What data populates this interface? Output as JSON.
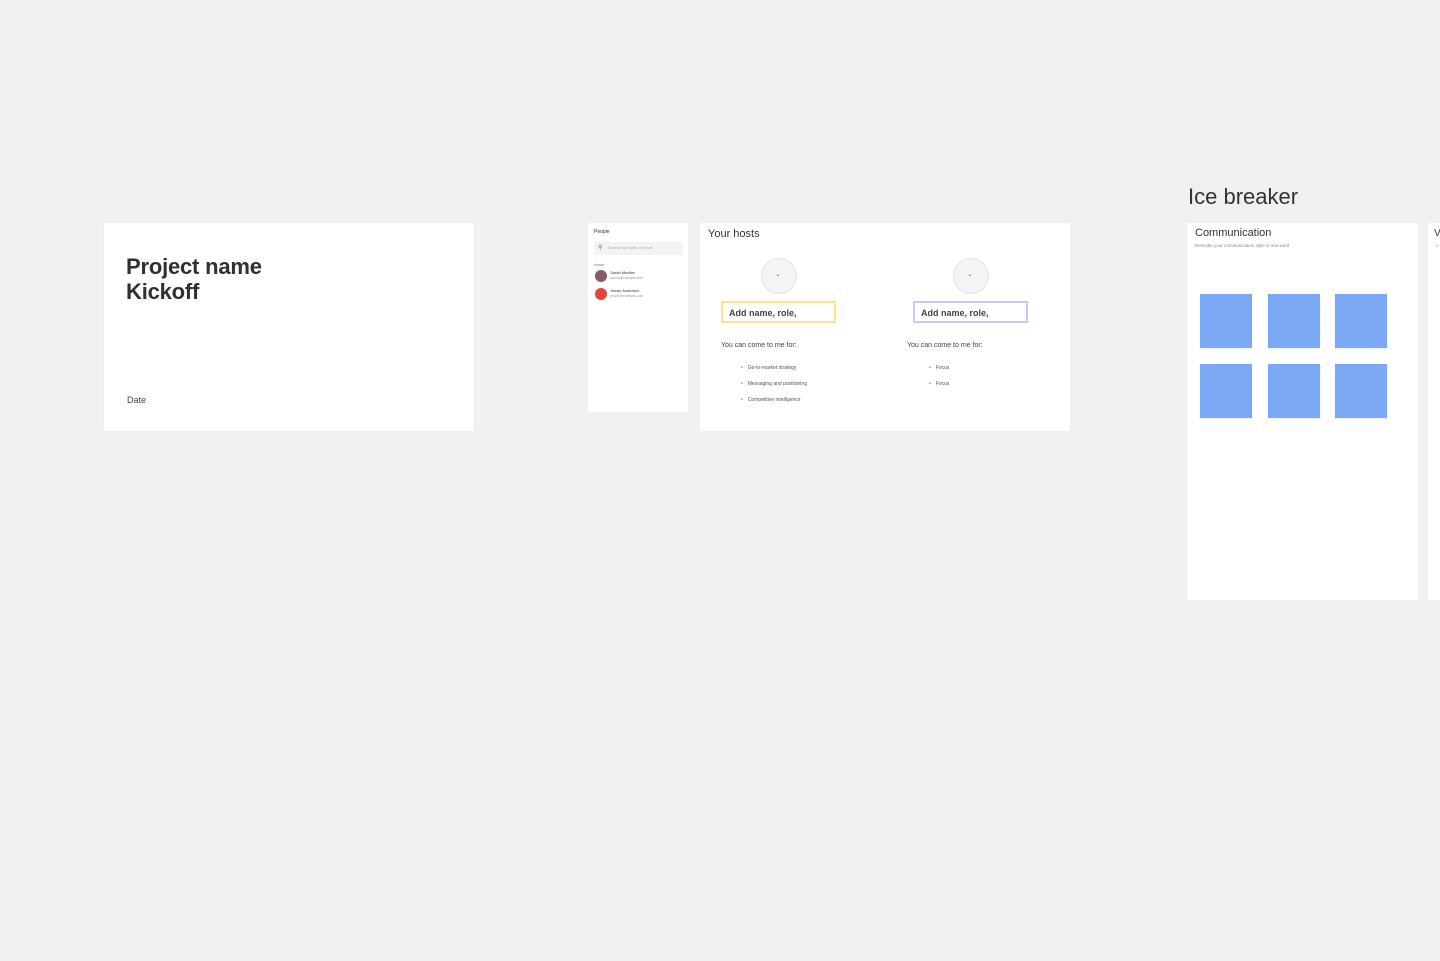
{
  "title_card": {
    "line1": "Project name",
    "line2": "Kickoff",
    "date": "Date"
  },
  "people_panel": {
    "header": "People",
    "search_placeholder": "Search by name or email",
    "section": "Hosts",
    "people": [
      {
        "name": "Sarah Mueller",
        "email": "sarah@example.com",
        "avatar_color": "#8a5a6a"
      },
      {
        "name": "Jessie Anderson",
        "email": "jessie@example.com",
        "avatar_color": "#e0463c"
      }
    ]
  },
  "hosts_card": {
    "title": "Your hosts",
    "hosts": [
      {
        "name_placeholder": "Add name, role,",
        "caption": "You can come to me for:",
        "items": [
          "Go-to-market strategy",
          "Messaging and positioning",
          "Competitive intelligence"
        ],
        "border_color": "#ffe58a"
      },
      {
        "name_placeholder": "Add name, role,",
        "caption": "You can come to me for:",
        "items": [
          "Focus",
          "Focus"
        ],
        "border_color": "#c9c9f7"
      }
    ]
  },
  "ice_breaker": {
    "title": "Ice breaker",
    "card_title": "Communication",
    "card_desc": "Describe your communication style in one word",
    "sticky_color": "#7aa8f5",
    "sticky_count": 6
  },
  "next_card": {
    "peek_text": "V",
    "peek_sub": "D"
  }
}
